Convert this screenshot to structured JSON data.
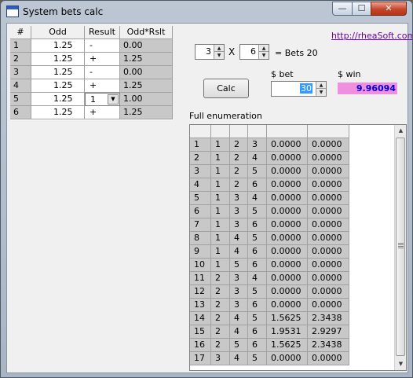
{
  "window": {
    "title": "System bets calc"
  },
  "window_controls": {
    "minimize": "—",
    "maximize": "☐",
    "close": "✕"
  },
  "bets_table": {
    "headers": [
      "#",
      "Odd",
      "Result",
      "Odd*Rslt"
    ],
    "rows": [
      {
        "num": "1",
        "odd": "1.25",
        "result": "-",
        "product": "0.00"
      },
      {
        "num": "2",
        "odd": "1.25",
        "result": "+",
        "product": "1.25"
      },
      {
        "num": "3",
        "odd": "1.25",
        "result": "-",
        "product": "0.00"
      },
      {
        "num": "4",
        "odd": "1.25",
        "result": "+",
        "product": "1.25"
      },
      {
        "num": "5",
        "odd": "1.25",
        "result": "1",
        "product": "1.00",
        "dropdown": true
      },
      {
        "num": "6",
        "odd": "1.25",
        "result": "+",
        "product": "1.25"
      }
    ]
  },
  "system": {
    "k": "3",
    "times": "X",
    "n": "6",
    "bets_label": "= Bets 20",
    "link": "http://rheaSoft.com"
  },
  "bet": {
    "label": "$ bet",
    "value": "30",
    "calc_label": "Calc"
  },
  "win": {
    "label": "$ win",
    "value": "9.96094"
  },
  "enumeration": {
    "title": "Full enumeration",
    "rows": [
      [
        "1",
        "1",
        "2",
        "3",
        "0.0000",
        "0.0000"
      ],
      [
        "2",
        "1",
        "2",
        "4",
        "0.0000",
        "0.0000"
      ],
      [
        "3",
        "1",
        "2",
        "5",
        "0.0000",
        "0.0000"
      ],
      [
        "4",
        "1",
        "2",
        "6",
        "0.0000",
        "0.0000"
      ],
      [
        "5",
        "1",
        "3",
        "4",
        "0.0000",
        "0.0000"
      ],
      [
        "6",
        "1",
        "3",
        "5",
        "0.0000",
        "0.0000"
      ],
      [
        "7",
        "1",
        "3",
        "6",
        "0.0000",
        "0.0000"
      ],
      [
        "8",
        "1",
        "4",
        "5",
        "0.0000",
        "0.0000"
      ],
      [
        "9",
        "1",
        "4",
        "6",
        "0.0000",
        "0.0000"
      ],
      [
        "10",
        "1",
        "5",
        "6",
        "0.0000",
        "0.0000"
      ],
      [
        "11",
        "2",
        "3",
        "4",
        "0.0000",
        "0.0000"
      ],
      [
        "12",
        "2",
        "3",
        "5",
        "0.0000",
        "0.0000"
      ],
      [
        "13",
        "2",
        "3",
        "6",
        "0.0000",
        "0.0000"
      ],
      [
        "14",
        "2",
        "4",
        "5",
        "1.5625",
        "2.3438"
      ],
      [
        "15",
        "2",
        "4",
        "6",
        "1.9531",
        "2.9297"
      ],
      [
        "16",
        "2",
        "5",
        "6",
        "1.5625",
        "2.3438"
      ],
      [
        "17",
        "3",
        "4",
        "5",
        "0.0000",
        "0.0000"
      ]
    ]
  }
}
